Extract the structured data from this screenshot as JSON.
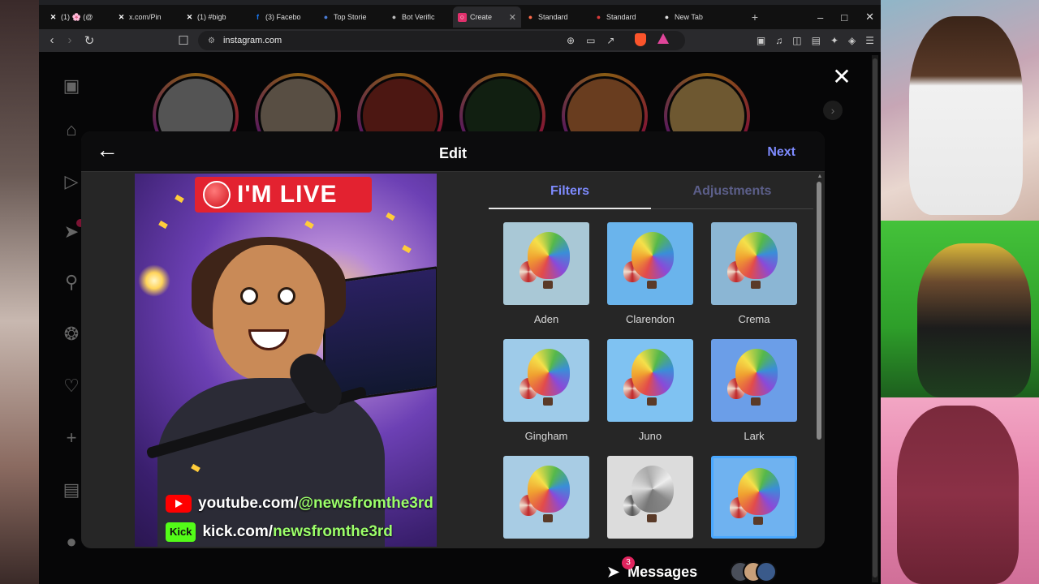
{
  "browser": {
    "tabs": [
      {
        "label": "(1) 🌸 (@",
        "icon": "x-icon",
        "color": "#ffffff"
      },
      {
        "label": "x.com/Pin",
        "icon": "x-icon",
        "color": "#ffffff"
      },
      {
        "label": "(1) #bigb",
        "icon": "x-icon",
        "color": "#ffffff"
      },
      {
        "label": "(3) Facebo",
        "icon": "facebook-icon",
        "color": "#1877f2"
      },
      {
        "label": "Top Storie",
        "icon": "news-icon",
        "color": "#4a7bd4"
      },
      {
        "label": "Bot Verific",
        "icon": "globe-icon",
        "color": "#bbbbbb"
      },
      {
        "label": "Create",
        "icon": "instagram-icon",
        "color": "#e1306c",
        "active": true
      },
      {
        "label": "Standard",
        "icon": "shield-icon",
        "color": "#ff6b4a"
      },
      {
        "label": "Standard",
        "icon": "shield-icon",
        "color": "#d93a3a"
      },
      {
        "label": "New Tab",
        "icon": "brave-icon",
        "color": "#dddddd"
      }
    ],
    "url": "instagram.com"
  },
  "editor": {
    "title": "Edit",
    "next_label": "Next",
    "tabs": {
      "filters": "Filters",
      "adjustments": "Adjustments"
    },
    "filters": [
      {
        "name": "Aden",
        "tint": "#a9c8d6",
        "selected": false,
        "gray": false
      },
      {
        "name": "Clarendon",
        "tint": "#6ab4ec",
        "selected": false,
        "gray": false
      },
      {
        "name": "Crema",
        "tint": "#8bb6d4",
        "selected": false,
        "gray": false
      },
      {
        "name": "Gingham",
        "tint": "#9ecbe9",
        "selected": false,
        "gray": false
      },
      {
        "name": "Juno",
        "tint": "#7fc2f2",
        "selected": false,
        "gray": false
      },
      {
        "name": "Lark",
        "tint": "#6b9ee8",
        "selected": false,
        "gray": false
      },
      {
        "name": "",
        "tint": "#a8cce4",
        "selected": false,
        "gray": false
      },
      {
        "name": "",
        "tint": "#dcdcdc",
        "selected": false,
        "gray": true
      },
      {
        "name": "",
        "tint": "#6fb2f0",
        "selected": true,
        "gray": false
      }
    ]
  },
  "preview": {
    "live_text": "I'M LIVE",
    "youtube_prefix": "youtube.com/",
    "youtube_handle": "@newsfromthe3rd",
    "kick_badge": "Kick",
    "kick_prefix": "kick.com/",
    "kick_handle": "newsfromthe3rd"
  },
  "messages": {
    "label": "Messages",
    "badge": "3"
  }
}
